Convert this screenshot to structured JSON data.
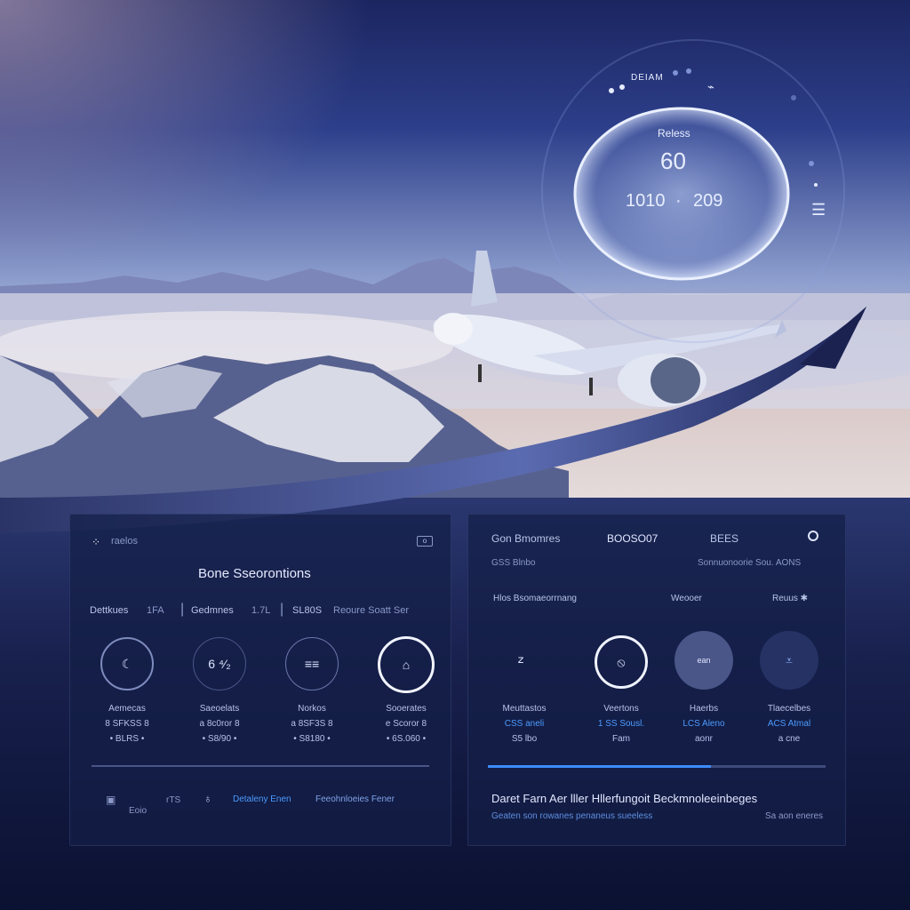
{
  "hud": {
    "top_label": "DEIAM",
    "title": "Reless",
    "main_value": "60",
    "left_value": "1010",
    "separator": "·",
    "right_value": "209"
  },
  "left_panel": {
    "header_label": "raelos",
    "title": "Bone Sseorontions",
    "stats": [
      {
        "label": "Dettkues",
        "value": "1FA"
      },
      {
        "label": "Gedmnes",
        "value": "1.7L"
      },
      {
        "label": "SL80S",
        "value": "Reoure Soatt Ser"
      }
    ],
    "gauges": [
      {
        "icon": "moon",
        "symbol": "",
        "name": "Aemecas",
        "line1": "8 SFKSS 8",
        "line2": "• BLRS •"
      },
      {
        "icon": "number",
        "symbol": "6 ⁴⁄₂",
        "name": "Saeoelats",
        "line1": "a 8c0ror 8",
        "line2": "• S8/90 •"
      },
      {
        "icon": "list",
        "symbol": "≡≡",
        "name": "Norkos",
        "line1": "a 8SF3S 8",
        "line2": "• S8180 •"
      },
      {
        "icon": "bag",
        "symbol": "",
        "name": "Sooerates",
        "line1": "e Scoror 8",
        "line2": "• 6S.060 •"
      }
    ],
    "footer": {
      "label1": "Eoio",
      "label2": "rTS",
      "link1": "Detaleny Enen",
      "link2": "Feeohnloeies Fener"
    }
  },
  "right_panel": {
    "row1": {
      "col1": "Gon Bmomres",
      "col2": "BOOSO07",
      "col3": "BEES"
    },
    "row2": {
      "col1": "GSS Blnbo",
      "col2": "Sonnuonoorie Sou. AONS"
    },
    "row3": {
      "col1": "Hlos Bsomaeorrnang",
      "col2": "Weooer",
      "col3": "Reuus ✱"
    },
    "tiles": [
      {
        "icon": "pin",
        "symbol": "𐌶",
        "name": "Meuttastos",
        "line1": "CSS aneli",
        "line2": "S5 lbo"
      },
      {
        "icon": "compass",
        "symbol": "",
        "name": "Veertons",
        "line1": "1 SS Sousl.",
        "line2": "Fam"
      },
      {
        "icon": "avatar",
        "symbol": "ean",
        "name": "Haerbs",
        "line1": "LCS Aleno",
        "line2": "aonr"
      },
      {
        "icon": "shield",
        "symbol": "",
        "name": "Tlaecelbes",
        "line1": "ACS Atmal",
        "line2": "a cne"
      }
    ],
    "progress": 0.66,
    "bottom_title": "Daret Farn Aer lller Hllerfungoit Beckmnoleeinbeges",
    "bottom_sub": "Geaten son rowanes penaneus sueeless",
    "bottom_right": "Sa aon eneres"
  },
  "colors": {
    "accent": "#4d9bff",
    "panel": "#14204a",
    "text": "#c9d3f0"
  }
}
